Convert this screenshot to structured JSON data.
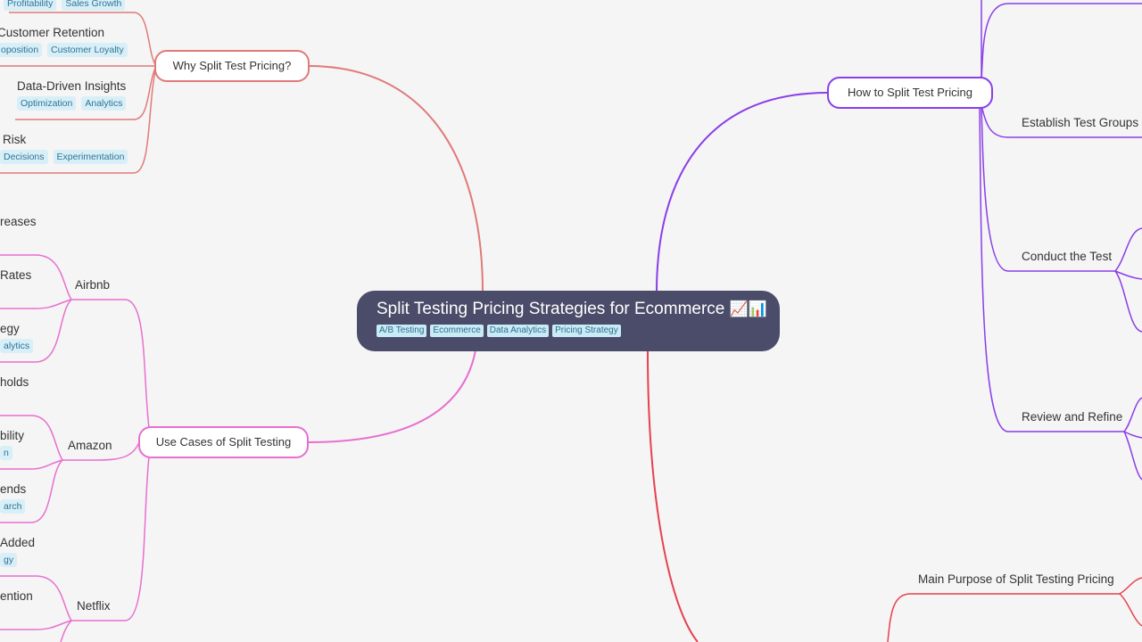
{
  "root": {
    "title": "Split Testing Pricing Strategies for Ecommerce",
    "emoji": "📈📊",
    "tags": [
      "A/B Testing",
      "Ecommerce",
      "Data Analytics",
      "Pricing Strategy"
    ]
  },
  "branches": {
    "why": {
      "label": "Why Split Test Pricing?",
      "color": "#e07a7a",
      "children": [
        {
          "label": "",
          "tags": [
            "Profitability",
            "Sales Growth"
          ]
        },
        {
          "label": "Customer Retention",
          "tags": [
            "oposition",
            "Customer Loyalty"
          ]
        },
        {
          "label": "Data-Driven Insights",
          "tags": [
            "Optimization",
            "Analytics"
          ]
        },
        {
          "label": "Risk",
          "tags": [
            "Decisions",
            "Experimentation"
          ]
        }
      ]
    },
    "use_cases": {
      "label": "Use Cases of Split Testing",
      "color": "#e86fd0",
      "children": [
        {
          "label": "Airbnb",
          "children": [
            {
              "label": "reases",
              "tags": []
            },
            {
              "label": "Rates",
              "tags": []
            },
            {
              "label": "egy",
              "tags": [
                "alytics"
              ]
            }
          ]
        },
        {
          "label": "Amazon",
          "children": [
            {
              "label": "holds",
              "tags": []
            },
            {
              "label": "bility",
              "tags": [
                "n"
              ]
            },
            {
              "label": "ends",
              "tags": [
                "arch"
              ]
            }
          ]
        },
        {
          "label": "Netflix",
          "children": [
            {
              "label": "Added",
              "tags": [
                "gy"
              ]
            },
            {
              "label": "ention",
              "tags": []
            }
          ]
        }
      ]
    },
    "how": {
      "label": "How to Split Test Pricing",
      "color": "#8a3ee8",
      "children": [
        {
          "label": "Establish Test Groups"
        },
        {
          "label": "Conduct the Test"
        },
        {
          "label": "Review and Refine"
        }
      ]
    },
    "purpose": {
      "color": "#e5414f",
      "children": [
        {
          "label": "Main Purpose of Split Testing Pricing"
        }
      ]
    }
  }
}
